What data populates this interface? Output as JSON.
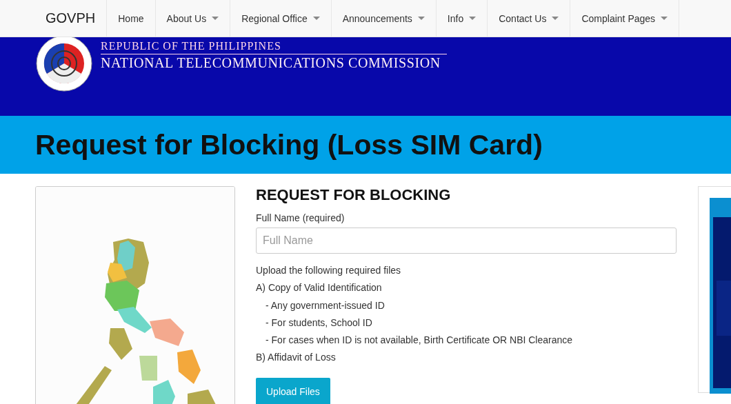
{
  "nav": {
    "brand": "GOVPH",
    "items": [
      {
        "label": "Home",
        "dropdown": false
      },
      {
        "label": "About Us",
        "dropdown": true
      },
      {
        "label": "Regional Office",
        "dropdown": true
      },
      {
        "label": "Announcements",
        "dropdown": true
      },
      {
        "label": "Info",
        "dropdown": true
      },
      {
        "label": "Contact Us",
        "dropdown": true
      },
      {
        "label": "Complaint Pages",
        "dropdown": true
      }
    ]
  },
  "header": {
    "line_1": "REPUBLIC OF THE PHILIPPINES",
    "line_2": "NATIONAL TELECOMMUNICATIONS COMMISSION"
  },
  "page_title": "Request for Blocking (Loss SIM Card)",
  "form": {
    "heading": "REQUEST FOR BLOCKING",
    "name_label": "Full Name (required)",
    "name_field": {
      "placeholder": "Full Name"
    },
    "instructions": [
      {
        "text": "Upload the following required files",
        "kind": "item"
      },
      {
        "text": "A) Copy of Valid Identification",
        "kind": "item"
      },
      {
        "text": "- Any government-issued ID",
        "kind": "sub"
      },
      {
        "text": "- For students, School ID",
        "kind": "sub"
      },
      {
        "text": "- For cases when ID is not available, Birth Certificate OR NBI Clearance",
        "kind": "sub"
      },
      {
        "text": "B) Affidavit of Loss",
        "kind": "item"
      }
    ],
    "upload_button": "Upload Files"
  }
}
